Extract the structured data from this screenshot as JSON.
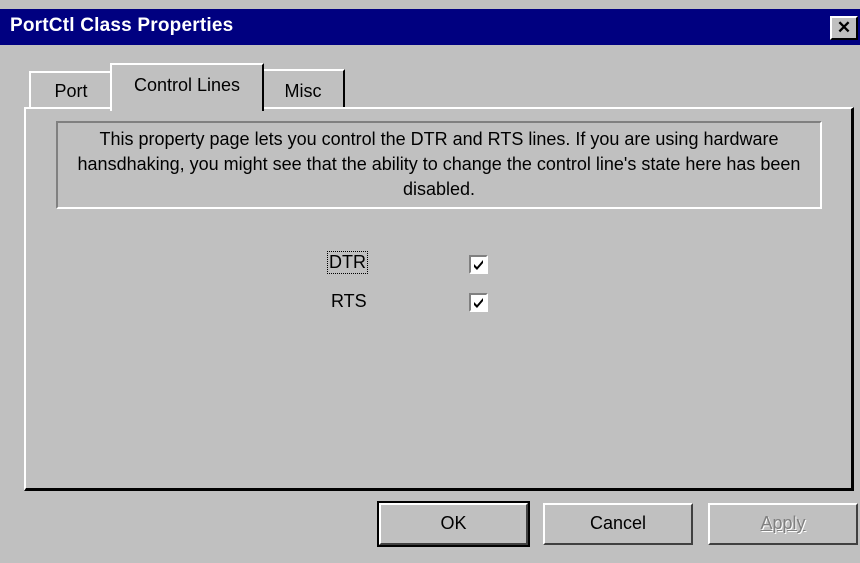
{
  "window": {
    "title": "PortCtl Class Properties",
    "close_symbol": "✕"
  },
  "tabs": [
    {
      "label": "Port"
    },
    {
      "label": "Control Lines"
    },
    {
      "label": "Misc"
    }
  ],
  "description": "This property page lets you control the DTR and RTS lines. If you are using hardware hansdhaking, you might see that the ability to change the control line's state here has been disabled.",
  "lines": {
    "dtr": {
      "label": "DTR",
      "checked": true
    },
    "rts": {
      "label": "RTS",
      "checked": true
    }
  },
  "buttons": {
    "ok": "OK",
    "cancel": "Cancel",
    "apply": "Apply"
  },
  "icons": {
    "close": "close-icon",
    "check": "checkmark-icon"
  },
  "colors": {
    "titlebar": "#000080",
    "face": "#c0c0c0"
  }
}
